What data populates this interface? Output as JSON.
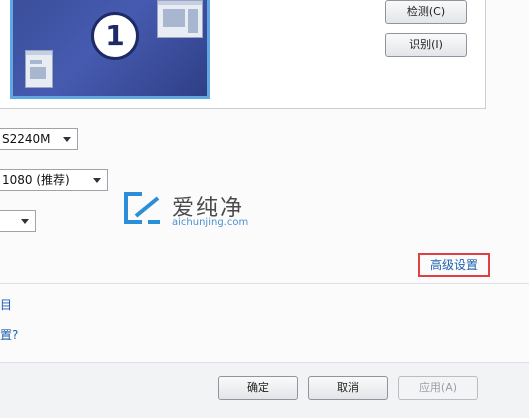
{
  "preview": {
    "monitor_number": "1"
  },
  "buttons": {
    "detect": "检测(C)",
    "identify": "识别(I)"
  },
  "dropdowns": {
    "display": "S2240M",
    "resolution": "1080 (推荐)",
    "orientation": ""
  },
  "watermark": {
    "brand": "爱纯净",
    "url": "aichunjing.com"
  },
  "advanced": {
    "label": "高级设置"
  },
  "links": {
    "link1": "目",
    "link2": "置?"
  },
  "footer": {
    "ok": "确定",
    "cancel": "取消",
    "apply": "应用(A)"
  },
  "colors": {
    "highlight_border": "#e04040",
    "link": "#1d5fb0",
    "monitor_blue": "#465ab0",
    "selection": "#5fa8e6"
  }
}
